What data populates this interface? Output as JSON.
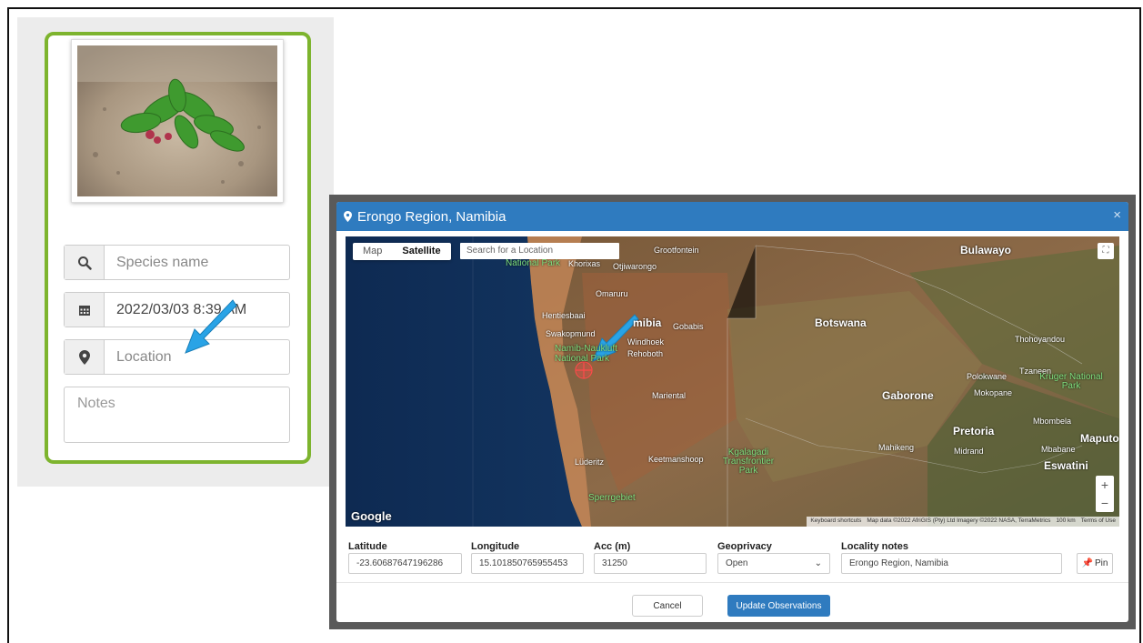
{
  "colors": {
    "card_border": "#7db42e",
    "modal_header": "#2f7bbf",
    "primary_button": "#2f7bbf",
    "arrow": "#29a3e6"
  },
  "form": {
    "species_placeholder": "Species name",
    "datetime_value": "2022/03/03 8:39 AM",
    "location_placeholder": "Location",
    "notes_placeholder": "Notes",
    "icons": [
      "search-icon",
      "calendar-icon",
      "map-marker-icon"
    ]
  },
  "modal": {
    "title": "Erongo Region, Namibia",
    "close_label": "×",
    "map": {
      "type_map": "Map",
      "type_satellite": "Satellite",
      "search_placeholder": "Search for a Location",
      "google": "Google",
      "zoom_in": "+",
      "zoom_out": "−",
      "attribution": [
        "Keyboard shortcuts",
        "Map data ©2022 AfriGIS (Pty) Ltd Imagery ©2022 NASA, TerraMetrics",
        "100 km",
        "Terms of Use"
      ],
      "labels": {
        "bulawayo": "Bulawayo",
        "botswana": "Botswana",
        "namibia": "mibia",
        "gaborone": "Gaborone",
        "pretoria": "Pretoria",
        "maputo": "Maputo",
        "eswatini": "Eswatini",
        "grootfontein": "Grootfontein",
        "national_park": "National Park",
        "khorixas": "Khorixas",
        "otjiwarongo": "Otjiwarongo",
        "omaruru": "Omaruru",
        "hentiesbaai": "Hentiesbaai",
        "swakopmund": "Swakopmund",
        "windhoek": "Windhoek",
        "rehoboth": "Rehoboth",
        "gobabis": "Gobabis",
        "mariental": "Mariental",
        "luderitz": "Lüderitz",
        "keetmanshoop": "Keetmanshoop",
        "kgalagadi": "Kgalagadi Transfrontier Park",
        "sperrgebiet": "Sperrgebiet",
        "namib": "Namib-Naukluft National Park",
        "mahikeng": "Mahikeng",
        "polokwane": "Polokwane",
        "mokopane": "Mokopane",
        "tzaneen": "Tzaneen",
        "kruger": "Kruger National Park",
        "thohoyandou": "Thohoyandou",
        "mbombela": "Mbombela",
        "midrand": "Midrand",
        "mbabane": "Mbabane"
      }
    },
    "fields": {
      "latitude_label": "Latitude",
      "latitude_value": "-23.60687647196286",
      "longitude_label": "Longitude",
      "longitude_value": "15.101850765955453",
      "acc_label": "Acc (m)",
      "acc_value": "31250",
      "geoprivacy_label": "Geoprivacy",
      "geoprivacy_value": "Open",
      "locality_label": "Locality notes",
      "locality_value": "Erongo Region, Namibia",
      "pin_label": "Pin"
    },
    "cancel_label": "Cancel",
    "update_label": "Update Observations"
  }
}
